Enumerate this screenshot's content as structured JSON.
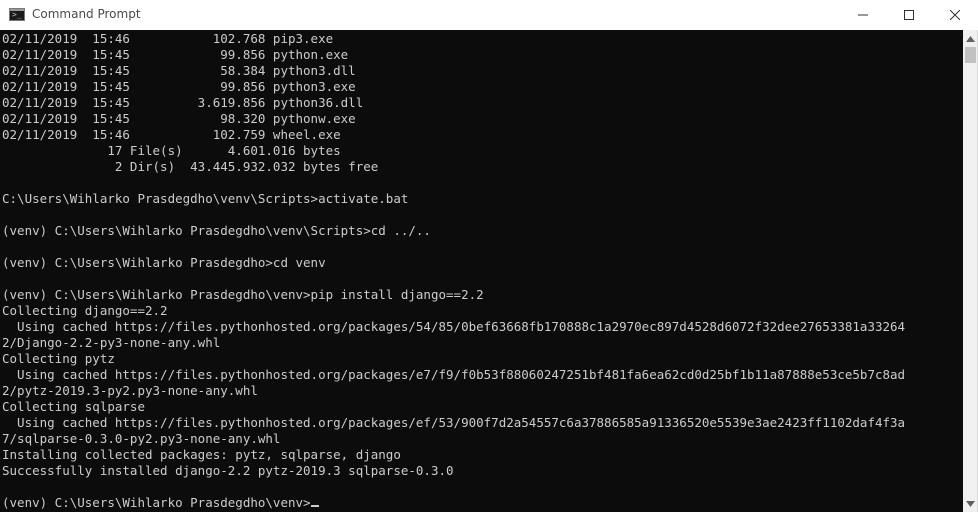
{
  "window": {
    "title": "Command Prompt",
    "icon": "cmd-icon",
    "controls": [
      "minimize-icon",
      "maximize-icon",
      "close-icon"
    ]
  },
  "terminal": {
    "background": "#0c0c0c",
    "foreground": "#cccccc",
    "lines": [
      "02/11/2019  15:46           102.768 pip3.exe",
      "02/11/2019  15:45            99.856 python.exe",
      "02/11/2019  15:45            58.384 python3.dll",
      "02/11/2019  15:45            99.856 python3.exe",
      "02/11/2019  15:45         3.619.856 python36.dll",
      "02/11/2019  15:45            98.320 pythonw.exe",
      "02/11/2019  15:46           102.759 wheel.exe",
      "              17 File(s)      4.601.016 bytes",
      "               2 Dir(s)  43.445.932.032 bytes free",
      "",
      "C:\\Users\\Wihlarko Prasdegdho\\venv\\Scripts>activate.bat",
      "",
      "(venv) C:\\Users\\Wihlarko Prasdegdho\\venv\\Scripts>cd ../..",
      "",
      "(venv) C:\\Users\\Wihlarko Prasdegdho>cd venv",
      "",
      "(venv) C:\\Users\\Wihlarko Prasdegdho\\venv>pip install django==2.2",
      "Collecting django==2.2",
      "  Using cached https://files.pythonhosted.org/packages/54/85/0bef63668fb170888c1a2970ec897d4528d6072f32dee27653381a33264",
      "2/Django-2.2-py3-none-any.whl",
      "Collecting pytz",
      "  Using cached https://files.pythonhosted.org/packages/e7/f9/f0b53f88060247251bf481fa6ea62cd0d25bf1b11a87888e53ce5b7c8ad",
      "2/pytz-2019.3-py2.py3-none-any.whl",
      "Collecting sqlparse",
      "  Using cached https://files.pythonhosted.org/packages/ef/53/900f7d2a54557c6a37886585a91336520e5539e3ae2423ff1102daf4f3a",
      "7/sqlparse-0.3.0-py2.py3-none-any.whl",
      "Installing collected packages: pytz, sqlparse, django",
      "Successfully installed django-2.2 pytz-2019.3 sqlparse-0.3.0",
      "",
      "(venv) C:\\Users\\Wihlarko Prasdegdho\\venv>"
    ]
  },
  "scrollbar": {
    "up_icon": "scroll-up-arrow-icon",
    "down_icon": "scroll-down-arrow-icon"
  }
}
